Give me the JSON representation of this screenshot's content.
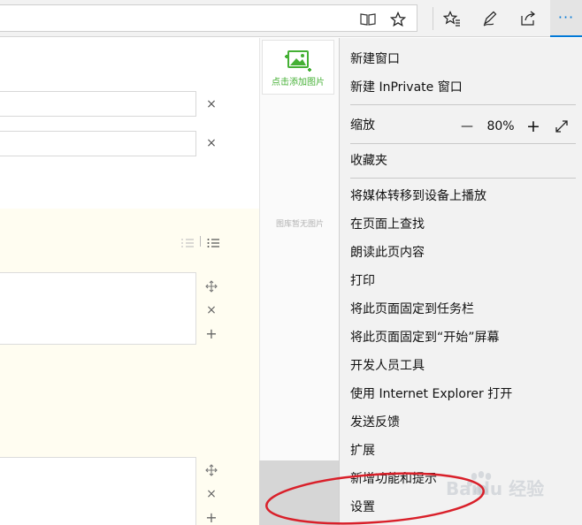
{
  "menu": {
    "new_window": "新建窗口",
    "new_inprivate": "新建 InPrivate 窗口",
    "zoom_label": "缩放",
    "zoom_minus": "—",
    "zoom_value": "80%",
    "zoom_plus": "+",
    "favorites": "收藏夹",
    "cast": "将媒体转移到设备上播放",
    "find": "在页面上查找",
    "read_aloud": "朗读此页内容",
    "print": "打印",
    "pin_taskbar": "将此页面固定到任务栏",
    "pin_start": "将此页面固定到“开始”屏幕",
    "dev_tools": "开发人员工具",
    "open_ie": "使用 Internet Explorer 打开",
    "feedback": "发送反馈",
    "extensions": "扩展",
    "whats_new": "新增功能和提示",
    "settings": "设置"
  },
  "image_panel": {
    "add_label": "点击添加图片",
    "empty_label": "图库暂无图片"
  },
  "watermark": {
    "text": "Baidu 经验"
  },
  "colors": {
    "accent": "#0078d7",
    "add_green": "#45b035",
    "highlight_ring": "#d9202a"
  }
}
